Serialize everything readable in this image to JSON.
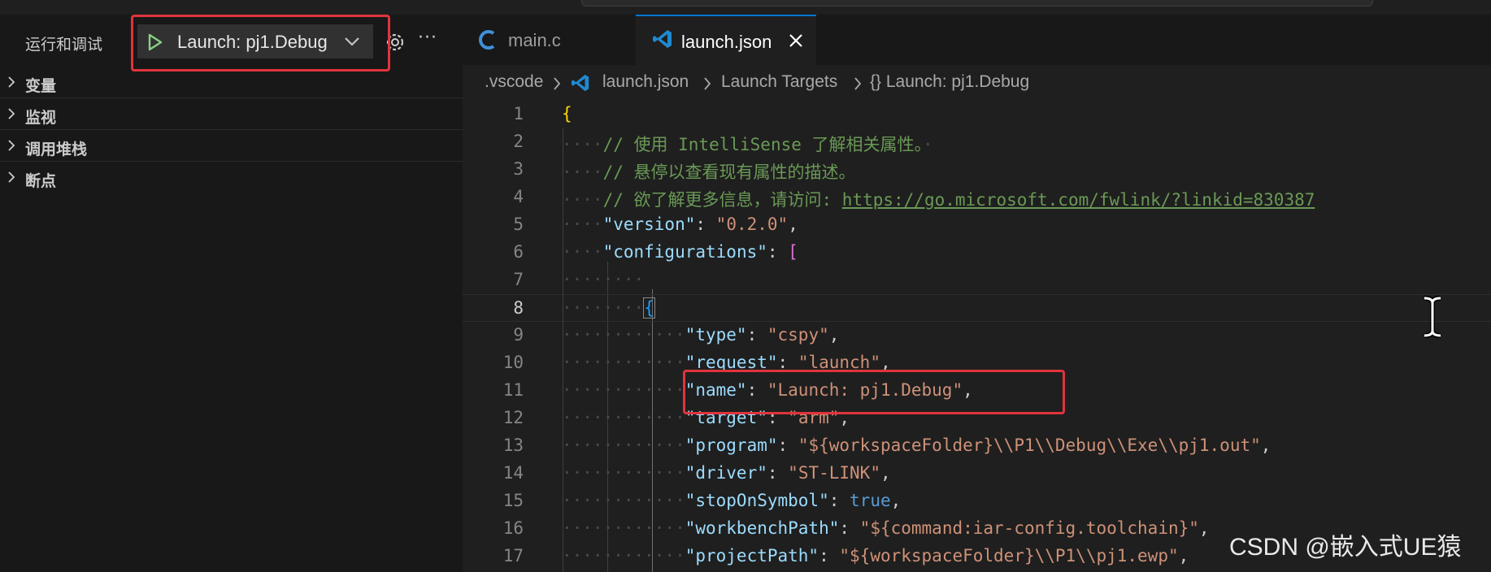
{
  "sidebar": {
    "title": "运行和调试",
    "launch_config": "Launch: pj1.Debug",
    "sections": [
      "变量",
      "监视",
      "调用堆栈",
      "断点"
    ]
  },
  "tabs": [
    {
      "label": "main.c",
      "icon": "c-file-icon"
    },
    {
      "label": "launch.json",
      "icon": "vscode-json-icon",
      "active": true
    }
  ],
  "breadcrumb": [
    ".vscode",
    "launch.json",
    "Launch Targets",
    "{} Launch: pj1.Debug"
  ],
  "editor": {
    "lines": [
      {
        "n": "1"
      },
      {
        "n": "2"
      },
      {
        "n": "3"
      },
      {
        "n": "4"
      },
      {
        "n": "5"
      },
      {
        "n": "6"
      },
      {
        "n": "7"
      },
      {
        "n": "8"
      },
      {
        "n": "9"
      },
      {
        "n": "10"
      },
      {
        "n": "11"
      },
      {
        "n": "12"
      },
      {
        "n": "13"
      },
      {
        "n": "14"
      },
      {
        "n": "15"
      },
      {
        "n": "16"
      },
      {
        "n": "17"
      }
    ],
    "comment1": "// 使用 IntelliSense 了解相关属性。",
    "comment2": "// 悬停以查看现有属性的描述。",
    "comment3_prefix": "// 欲了解更多信息，请访问: ",
    "comment3_url": "https://go.microsoft.com/fwlink/?linkid=830387",
    "version_key": "\"version\"",
    "version_val": "\"0.2.0\"",
    "configurations_key": "\"configurations\"",
    "type_key": "\"type\"",
    "type_val": "\"cspy\"",
    "request_key": "\"request\"",
    "request_val": "\"launch\"",
    "name_key": "\"name\"",
    "name_val": "\"Launch: pj1.Debug\"",
    "target_key": "\"target\"",
    "target_val": "\"arm\"",
    "program_key": "\"program\"",
    "program_val": "\"${workspaceFolder}\\\\P1\\\\Debug\\\\Exe\\\\pj1.out\"",
    "driver_key": "\"driver\"",
    "driver_val": "\"ST-LINK\"",
    "stop_key": "\"stopOnSymbol\"",
    "stop_val": "true",
    "workbench_key": "\"workbenchPath\"",
    "workbench_val": "\"${command:iar-config.toolchain}\"",
    "project_key": "\"projectPath\"",
    "project_val": "\"${workspaceFolder}\\\\P1\\\\pj1.ewp\""
  },
  "watermark": "CSDN @嵌入式UE猿",
  "colors": {
    "accent": "#0078d4",
    "highlight_box": "#e0343d",
    "play": "#89d185"
  }
}
